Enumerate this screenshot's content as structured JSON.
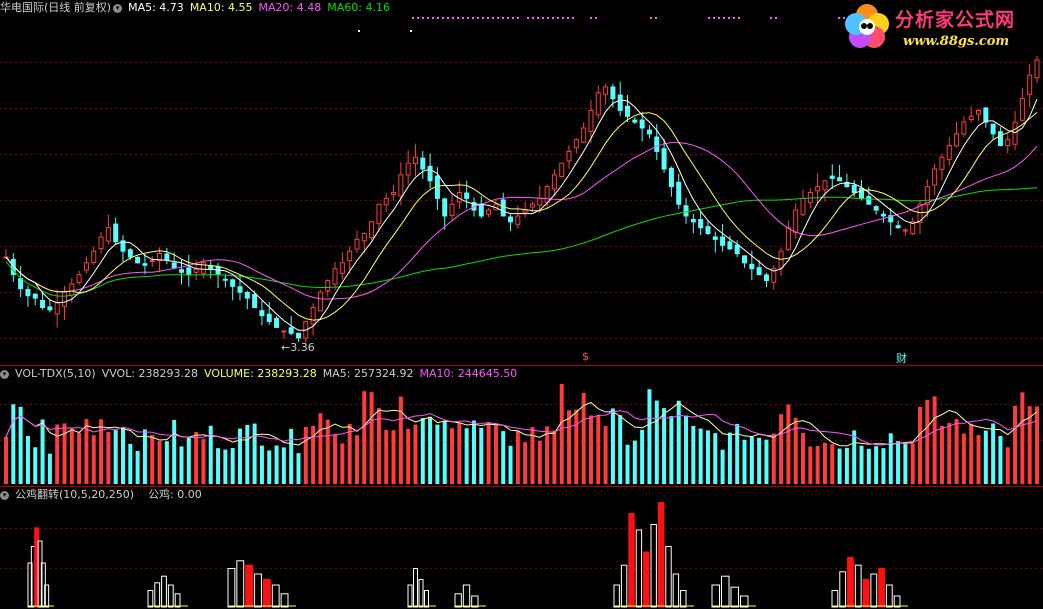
{
  "price_header": {
    "title": "华电国际(日线 前复权)",
    "ma5": "MA5: 4.73",
    "ma10": "MA10: 4.55",
    "ma20": "MA20: 4.48",
    "ma60": "MA60: 4.16"
  },
  "vol_header": {
    "title": "VOL-TDX(5,10)",
    "vvol": "VVOL: 238293.28",
    "volume": "VOLUME: 238293.28",
    "ma5": "MA5: 257324.92",
    "ma10": "MA10: 244645.50"
  },
  "ind_header": {
    "title": "公鸡翻转(10,5,20,250)",
    "value": "公鸡: 0.00"
  },
  "low_marker": "3.36",
  "event_markers": [
    "$",
    "财"
  ],
  "logo": {
    "title": "分析家公式网",
    "url": "www.88gs.com"
  },
  "colors": {
    "up": "#ff3b3b",
    "down": "#54ffff",
    "ma5": "#ffffff",
    "ma10": "#ffff54",
    "ma20": "#ff54ff",
    "ma60": "#00e000",
    "grid": "#7a0000"
  },
  "chart_data": [
    {
      "type": "candlestick",
      "title": "华电国际(日线 前复权)",
      "description_series": [
        "MA5",
        "MA10",
        "MA20",
        "MA60"
      ],
      "ohlc_close": [
        4.05,
        3.9,
        3.78,
        3.72,
        3.7,
        3.62,
        3.6,
        3.66,
        3.75,
        3.82,
        3.9,
        4.0,
        4.1,
        4.22,
        4.3,
        4.18,
        4.1,
        4.05,
        4.0,
        3.98,
        4.02,
        4.08,
        4.02,
        3.96,
        3.92,
        3.9,
        3.95,
        4.0,
        3.95,
        3.9,
        3.86,
        3.8,
        3.75,
        3.7,
        3.62,
        3.55,
        3.5,
        3.45,
        3.42,
        3.4,
        3.36,
        3.5,
        3.62,
        3.75,
        3.85,
        3.95,
        4.0,
        4.1,
        4.2,
        4.25,
        4.35,
        4.5,
        4.55,
        4.6,
        4.75,
        4.85,
        4.9,
        4.8,
        4.7,
        4.55,
        4.4,
        4.5,
        4.6,
        4.55,
        4.45,
        4.4,
        4.45,
        4.5,
        4.4,
        4.35,
        4.4,
        4.45,
        4.5,
        4.55,
        4.65,
        4.75,
        4.85,
        4.95,
        5.05,
        5.15,
        5.3,
        5.45,
        5.5,
        5.4,
        5.3,
        5.25,
        5.2,
        5.15,
        5.1,
        4.95,
        4.8,
        4.65,
        4.5,
        4.4,
        4.35,
        4.3,
        4.25,
        4.2,
        4.15,
        4.12,
        4.08,
        4.0,
        3.95,
        3.9,
        3.85,
        3.95,
        4.1,
        4.3,
        4.45,
        4.55,
        4.6,
        4.65,
        4.7,
        4.72,
        4.7,
        4.65,
        4.6,
        4.55,
        4.5,
        4.45,
        4.4,
        4.35,
        4.3,
        4.28,
        4.35,
        4.5,
        4.65,
        4.8,
        4.9,
        5.0,
        5.1,
        5.2,
        5.25,
        5.3,
        5.2,
        5.1,
        5.0,
        5.05,
        5.2,
        5.4,
        5.6,
        5.73
      ],
      "yrange": [
        3.3,
        5.9
      ],
      "annotations": [
        "3.36"
      ]
    },
    {
      "type": "bar",
      "title": "VOL-TDX(5,10)",
      "series": [
        {
          "name": "VOLUME",
          "values_note": "daily volume bars"
        }
      ],
      "latest": {
        "VVOL": 238293.28,
        "VOLUME": 238293.28,
        "MA5": 257324.92,
        "MA10": 244645.5
      }
    },
    {
      "type": "bar",
      "title": "公鸡翻转(10,5,20,250)",
      "latest": {
        "公鸡": 0.0
      }
    }
  ]
}
